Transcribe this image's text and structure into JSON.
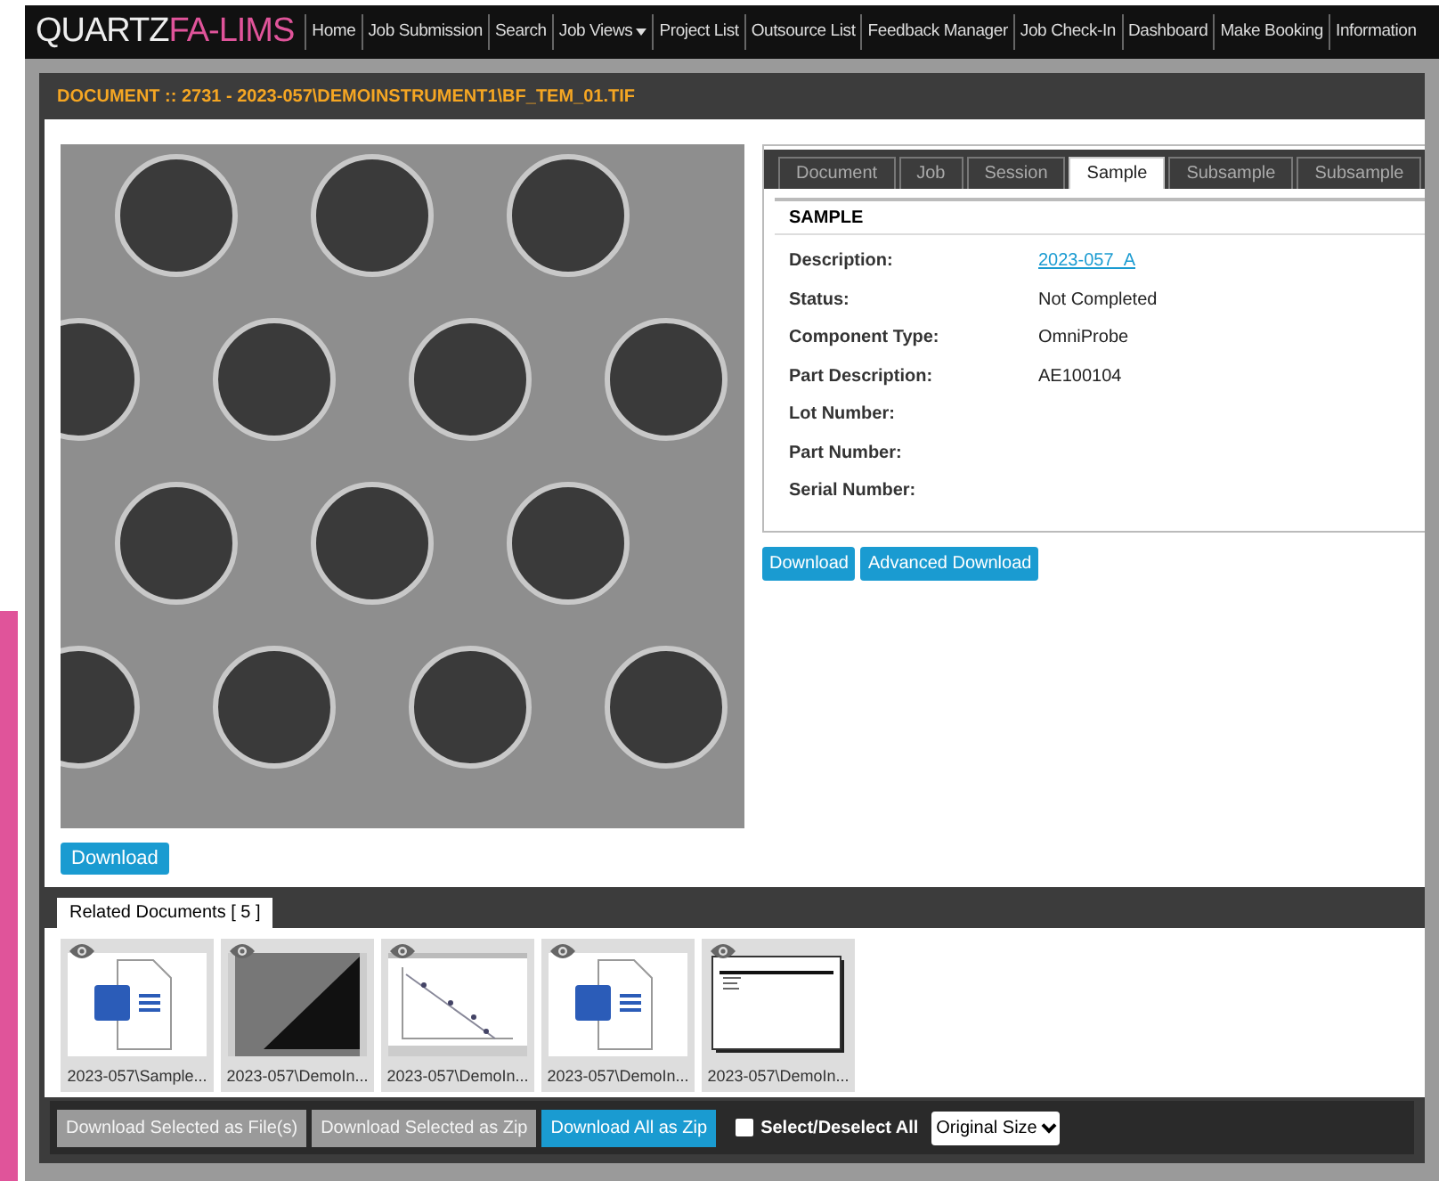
{
  "app": {
    "logo_left": "QUARTZ",
    "logo_right": "FA-LIMS"
  },
  "nav": [
    {
      "label": "Home",
      "dropdown": false
    },
    {
      "label": "Job Submission",
      "dropdown": false
    },
    {
      "label": "Search",
      "dropdown": false
    },
    {
      "label": "Job Views",
      "dropdown": true
    },
    {
      "label": "Project List",
      "dropdown": false
    },
    {
      "label": "Outsource List",
      "dropdown": false
    },
    {
      "label": "Feedback Manager",
      "dropdown": false
    },
    {
      "label": "Job Check-In",
      "dropdown": false
    },
    {
      "label": "Dashboard",
      "dropdown": false
    },
    {
      "label": "Make Booking",
      "dropdown": false
    },
    {
      "label": "Information",
      "dropdown": false
    }
  ],
  "panel": {
    "title": "DOCUMENT :: 2731 - 2023-057\\DEMOINSTRUMENT1\\BF_TEM_01.TIF"
  },
  "image_download": "Download",
  "tabs": [
    {
      "label": "Document",
      "selected": false
    },
    {
      "label": "Job",
      "selected": false
    },
    {
      "label": "Session",
      "selected": false
    },
    {
      "label": "Sample",
      "selected": true
    },
    {
      "label": "Subsample",
      "selected": false
    },
    {
      "label": "Subsample",
      "selected": false
    }
  ],
  "section_title": "SAMPLE",
  "fields": [
    {
      "label": "Description:",
      "value": "2023-057_A",
      "kind": "link"
    },
    {
      "label": "Status:",
      "value": "Not Completed",
      "kind": "text"
    },
    {
      "label": "Component Type:",
      "value": "OmniProbe",
      "kind": "text"
    },
    {
      "label": "Part Description:",
      "value": "AE100104",
      "kind": "text"
    },
    {
      "label": "Lot Number:"
    },
    {
      "label": "Part Number:"
    },
    {
      "label": "Serial Number:"
    }
  ],
  "detail_buttons": [
    "Download",
    "Advanced Download"
  ],
  "related": {
    "tab": "Related Documents [  5  ]",
    "documents": [
      {
        "name": "2023-057\\Sample...",
        "kind": "word"
      },
      {
        "name": "2023-057\\DemoIn...",
        "kind": "image"
      },
      {
        "name": "2023-057\\DemoIn...",
        "kind": "chart"
      },
      {
        "name": "2023-057\\DemoIn...",
        "kind": "word"
      },
      {
        "name": "2023-057\\DemoIn...",
        "kind": "document"
      }
    ]
  },
  "toolbar": {
    "buttons": [
      {
        "label": "Download Selected as File(s)",
        "disabled": true
      },
      {
        "label": "Download Selected as Zip",
        "disabled": true
      },
      {
        "label": "Download All as Zip",
        "disabled": false
      }
    ],
    "select_all": {
      "label": "Select/Deselect All",
      "checked": false
    },
    "size": "Original Size"
  }
}
